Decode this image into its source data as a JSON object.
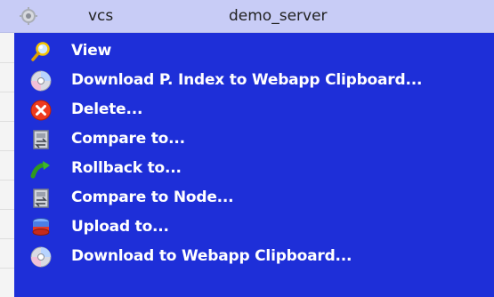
{
  "header_row": {
    "col_type": "vcs",
    "col_name": "demo_server"
  },
  "context_menu": {
    "items": [
      {
        "label": "View",
        "icon": "magnifier-icon"
      },
      {
        "label": "Download P. Index to Webapp Clipboard...",
        "icon": "disc-download-icon"
      },
      {
        "label": "Delete...",
        "icon": "delete-icon"
      },
      {
        "label": "Compare to...",
        "icon": "compare-icon"
      },
      {
        "label": "Rollback to...",
        "icon": "rollback-arrow-icon"
      },
      {
        "label": "Compare to Node...",
        "icon": "compare-icon"
      },
      {
        "label": "Upload to...",
        "icon": "upload-icon"
      },
      {
        "label": "Download to Webapp Clipboard...",
        "icon": "disc-download-icon"
      }
    ]
  },
  "colors": {
    "menu_background": "#1e2fd8",
    "header_background": "#c8ccf6",
    "menu_text": "#ffffff"
  }
}
